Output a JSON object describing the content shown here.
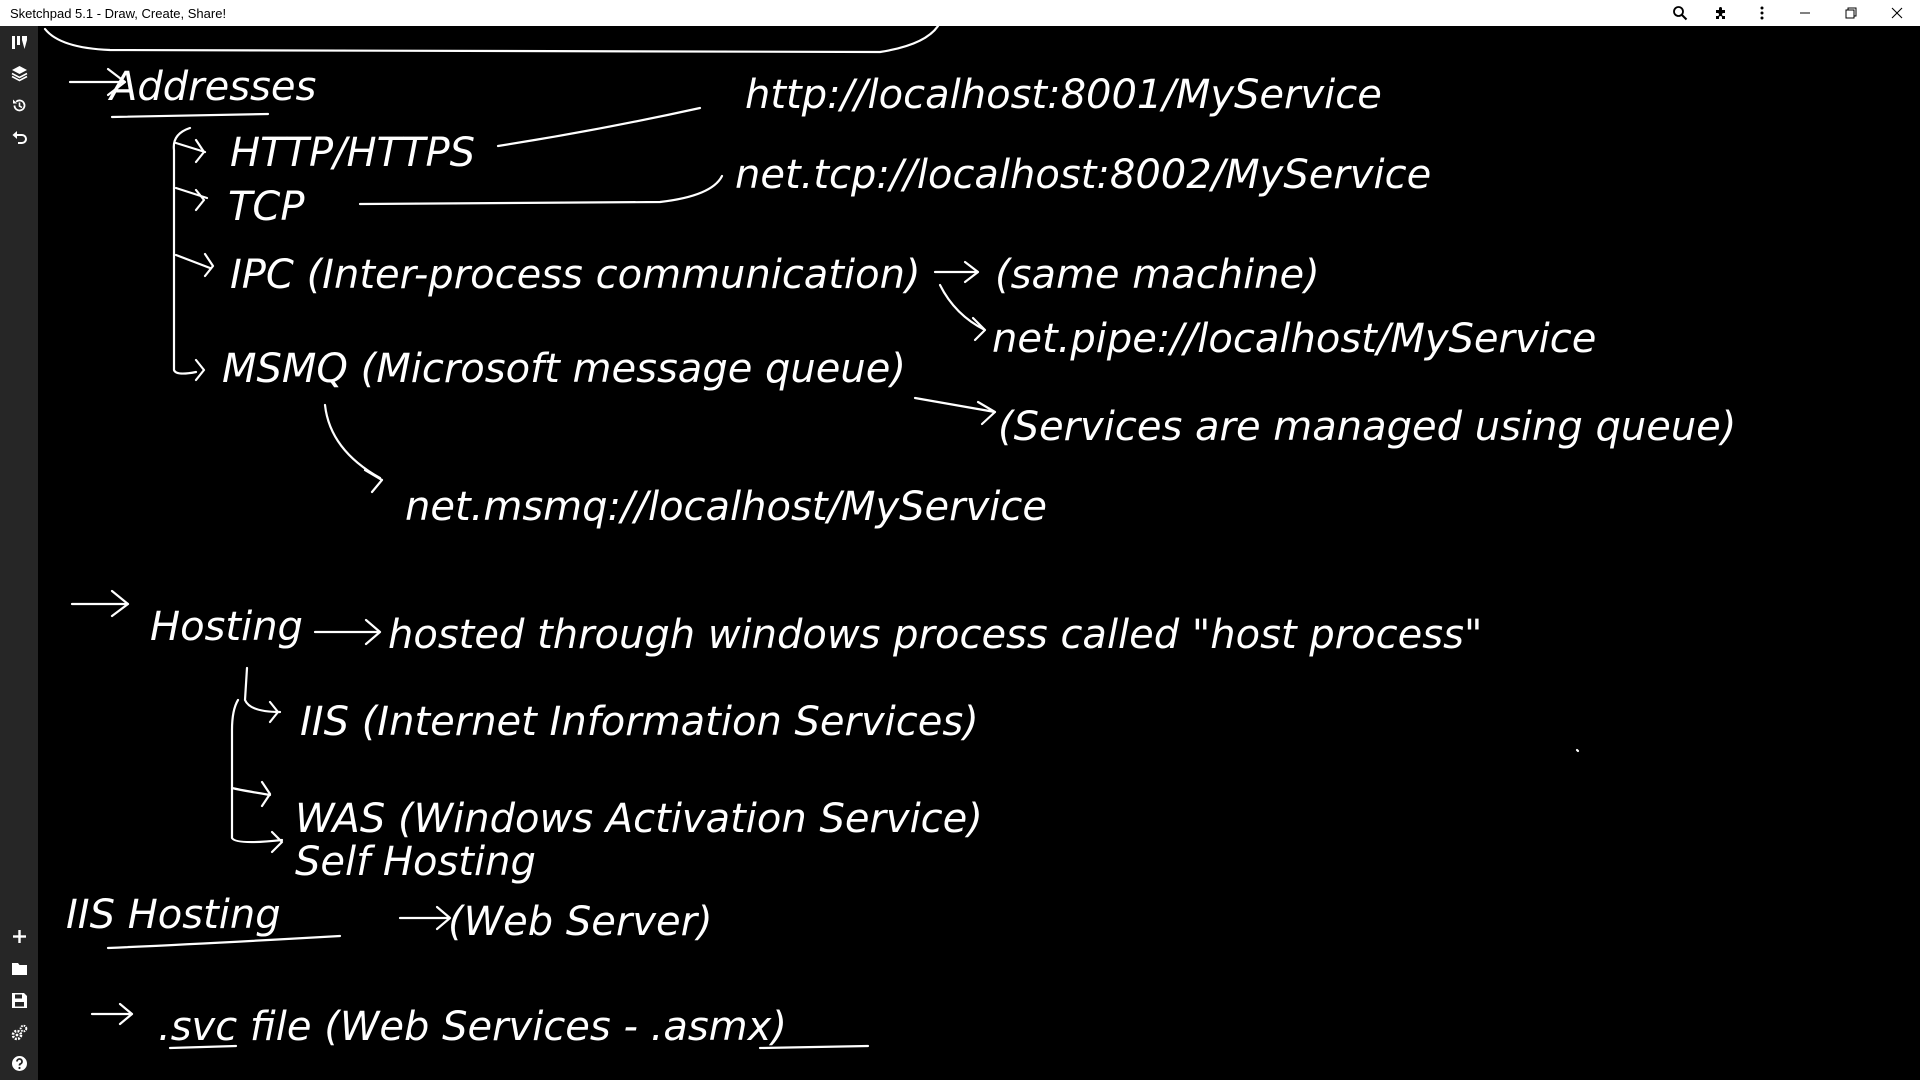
{
  "window": {
    "title": "Sketchpad 5.1 - Draw, Create, Share!",
    "icons": [
      "search-icon",
      "extensions-icon",
      "more-vertical-icon",
      "minimize-icon",
      "restore-icon",
      "close-icon"
    ]
  },
  "toolbar": {
    "top_icons": [
      "tools-icon",
      "layers-icon",
      "history-icon",
      "undo-icon"
    ],
    "bottom_icons": [
      "add-icon",
      "folder-icon",
      "save-icon",
      "settings-icon",
      "help-icon"
    ]
  },
  "notes": {
    "addresses": {
      "heading": "Addresses",
      "http": "HTTP/HTTPS",
      "http_url": "http://localhost:8001/MyService",
      "tcp": "TCP",
      "tcp_url": "net.tcp://localhost:8002/MyService",
      "ipc": "IPC (Inter-process communication)",
      "ipc_note": "(same machine)",
      "ipc_url": "net.pipe://localhost/MyService",
      "msmq": "MSMQ (Microsoft message queue)",
      "msmq_note": "(Services are managed using queue)",
      "msmq_url": "net.msmq://localhost/MyService"
    },
    "hosting": {
      "heading": "Hosting",
      "desc": "hosted through windows process called \"host process\"",
      "iis": "IIS (Internet Information Services)",
      "was": "WAS (Windows Activation Service)",
      "self": "Self Hosting"
    },
    "iis_hosting": {
      "heading": "IIS Hosting",
      "note": "(Web Server)"
    },
    "svc": {
      "text": ".svc file (Web Services - .asmx)"
    }
  }
}
